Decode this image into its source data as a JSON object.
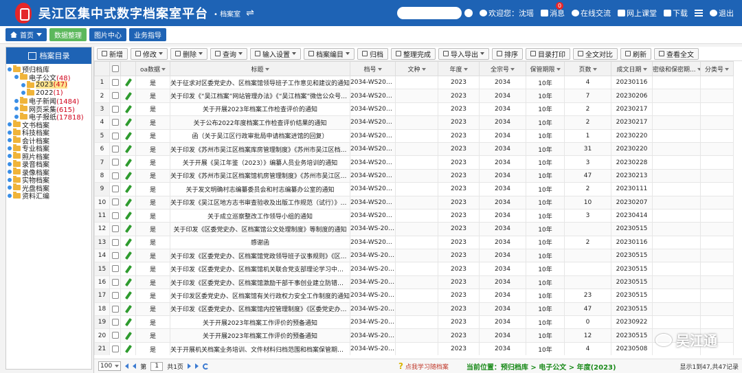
{
  "header": {
    "title": "吴江区集中式数字档案室平台",
    "subtitle": "• 档案室",
    "swap_icon": "swap-icon",
    "nav": [
      {
        "label": "欢迎您：沈瑶",
        "icon": "user-icon"
      },
      {
        "label": "消息",
        "icon": "mail-icon",
        "badge": "0"
      },
      {
        "label": "在线交流",
        "icon": "chat-icon"
      },
      {
        "label": "网上课堂",
        "icon": "screen-icon"
      },
      {
        "label": "下载",
        "icon": "download-icon"
      },
      {
        "label": "退出",
        "icon": "power-icon"
      }
    ]
  },
  "topmenu": {
    "home": "首页",
    "items": [
      "数据整理",
      "图片中心",
      "业务指导"
    ]
  },
  "sidebar": {
    "title": "档案目录",
    "tree": [
      {
        "label": "预归档库",
        "count": "",
        "level": 0
      },
      {
        "label": "电子公文",
        "count": "(48)",
        "level": 1
      },
      {
        "label": "2023",
        "count": "(47)",
        "level": 2,
        "selected": true
      },
      {
        "label": "2022",
        "count": "(1)",
        "level": 2
      },
      {
        "label": "电子新闻",
        "count": "(1484)",
        "level": 1
      },
      {
        "label": "网页采集",
        "count": "(615)",
        "level": 1
      },
      {
        "label": "电子报纸",
        "count": "(17818)",
        "level": 1
      },
      {
        "label": "文书档案",
        "count": "",
        "level": 0
      },
      {
        "label": "科技档案",
        "count": "",
        "level": 0
      },
      {
        "label": "会计档案",
        "count": "",
        "level": 0
      },
      {
        "label": "专业档案",
        "count": "",
        "level": 0
      },
      {
        "label": "照片档案",
        "count": "",
        "level": 0
      },
      {
        "label": "录音档案",
        "count": "",
        "level": 0
      },
      {
        "label": "录像档案",
        "count": "",
        "level": 0
      },
      {
        "label": "实物档案",
        "count": "",
        "level": 0
      },
      {
        "label": "光盘档案",
        "count": "",
        "level": 0
      },
      {
        "label": "资料汇编",
        "count": "",
        "level": 0
      }
    ]
  },
  "toolbar": [
    {
      "label": "新增",
      "caret": false
    },
    {
      "label": "修改",
      "caret": true
    },
    {
      "label": "删除",
      "caret": true
    },
    {
      "label": "查询",
      "caret": true
    },
    {
      "label": "输入设置",
      "caret": true
    },
    {
      "label": "档案编目",
      "caret": true
    },
    {
      "label": "归档",
      "caret": false
    },
    {
      "label": "整理完成",
      "caret": false
    },
    {
      "label": "导入导出",
      "caret": true
    },
    {
      "label": "排序",
      "caret": false
    },
    {
      "label": "目录打印",
      "caret": false
    },
    {
      "label": "全文对比",
      "caret": false
    },
    {
      "label": "刷新",
      "caret": false
    },
    {
      "label": "查看全文",
      "caret": false
    }
  ],
  "table": {
    "columns": [
      "",
      "",
      "",
      "oa数据",
      "标题",
      "档号",
      "文种",
      "年度",
      "全宗号",
      "保管期限",
      "页数",
      "成文日期",
      "密级和保密期...",
      "分类号"
    ],
    "rows": [
      [
        "1",
        "是",
        "关于征求对区委党史办、区档案馆领导班子工作意见和建议的通知",
        "2034-WS2023...",
        "",
        "2023",
        "2034",
        "10年",
        "4",
        "20230116",
        "",
        ""
      ],
      [
        "2",
        "是",
        "关于印发《“吴江档案”网站管理办法》《“吴江档案”微信公众号管理办...",
        "2034-WS2023...",
        "",
        "2023",
        "2034",
        "10年",
        "7",
        "20230206",
        "",
        ""
      ],
      [
        "3",
        "是",
        "关于开展2023年档案工作检查评价的通知",
        "2034-WS2023...",
        "",
        "2023",
        "2034",
        "10年",
        "2",
        "20230217",
        "",
        ""
      ],
      [
        "4",
        "是",
        "关于公布2022年度档案工作检查评价结果的通知",
        "2034-WS2023...",
        "",
        "2023",
        "2034",
        "10年",
        "2",
        "20230217",
        "",
        ""
      ],
      [
        "5",
        "是",
        "函（关于吴江区行政审批局申请档案进馆的回复）",
        "2034-WS2023...",
        "",
        "2023",
        "2034",
        "10年",
        "1",
        "20230220",
        "",
        ""
      ],
      [
        "6",
        "是",
        "关于印发《苏州市吴江区档案库房管理制度》《苏州市吴江区档案馆...",
        "2034-WS2023...",
        "",
        "2023",
        "2034",
        "10年",
        "31",
        "20230220",
        "",
        ""
      ],
      [
        "7",
        "是",
        "关于开展《吴江年鉴（2023）》编纂人员业务培训的通知",
        "2034-WS2023...",
        "",
        "2023",
        "2034",
        "10年",
        "3",
        "20230228",
        "",
        ""
      ],
      [
        "8",
        "是",
        "关于印发《苏州市吴江区档案馆机房管理制度》《苏州市吴江区数字档...",
        "2034-WS2023...",
        "",
        "2023",
        "2034",
        "10年",
        "47",
        "20230213",
        "",
        ""
      ],
      [
        "9",
        "是",
        "关于发文明确村志编纂委员会和村志编纂办公室的通知",
        "2034-WS2023...",
        "",
        "2023",
        "2034",
        "10年",
        "2",
        "20230111",
        "",
        ""
      ],
      [
        "10",
        "是",
        "关于印发《吴江区地方志书审查验收及出版工作规范（试行）》的通知",
        "2034-WS2023...",
        "",
        "2023",
        "2034",
        "10年",
        "10",
        "20230207",
        "",
        ""
      ],
      [
        "11",
        "是",
        "关于成立巡察整改工作领导小组的通知",
        "2034-WS2023...",
        "",
        "2023",
        "2034",
        "10年",
        "3",
        "20230414",
        "",
        ""
      ],
      [
        "12",
        "是",
        "关于印发《区委党史办、区档案馆公文处理制度》等制度的通知",
        "2034-WS-202...",
        "",
        "2023",
        "2034",
        "10年",
        "",
        "20230515",
        "",
        ""
      ],
      [
        "13",
        "是",
        "感谢函",
        "2034-WS2023...",
        "",
        "2023",
        "2034",
        "10年",
        "2",
        "20230116",
        "",
        ""
      ],
      [
        "14",
        "是",
        "关于印发《区委党史办、区档案馆党政领导班子议事规则》《区委党史...",
        "2034-WS-202...",
        "",
        "2023",
        "2034",
        "10年",
        "",
        "20230515",
        "",
        ""
      ],
      [
        "15",
        "是",
        "关于印发《区委党史办、区档案馆机关联合党支部理论学习中心组学习...",
        "2034-WS-202...",
        "",
        "2023",
        "2034",
        "10年",
        "",
        "20230515",
        "",
        ""
      ],
      [
        "16",
        "是",
        "关于印发《区委党史办、区档案馆激励干部干事创业建立防错容错纠错...",
        "2034-WS-202...",
        "",
        "2023",
        "2034",
        "10年",
        "",
        "20230515",
        "",
        ""
      ],
      [
        "17",
        "是",
        "关于印发区委党史办、区档案馆有关行政权力安全工作制度的通知",
        "2034-WS-202...",
        "",
        "2023",
        "2034",
        "10年",
        "23",
        "20230515",
        "",
        ""
      ],
      [
        "18",
        "是",
        "关于印发《区委党史办、区档案馆内控管理制度》《区委党史办、区档...",
        "2034-WS-202...",
        "",
        "2023",
        "2034",
        "10年",
        "47",
        "20230515",
        "",
        ""
      ],
      [
        "19",
        "是",
        "关于开展2023年档案工作评价的预备通知",
        "2034-WS-202...",
        "",
        "2023",
        "2034",
        "10年",
        "0",
        "20230922",
        "",
        ""
      ],
      [
        "20",
        "是",
        "关于开展2023年档案工作评价的预备通知",
        "2034-WS-202...",
        "",
        "2023",
        "2034",
        "10年",
        "12",
        "20230515",
        "",
        ""
      ],
      [
        "21",
        "是",
        "关于开展机关档案业务培训、文件材料归档范围和档案保管期限表三个...",
        "2034-WS-202...",
        "",
        "2023",
        "2034",
        "10年",
        "4",
        "20230508",
        "",
        ""
      ]
    ]
  },
  "pager": {
    "page_size": "100",
    "page_prefix": "第",
    "page_value": "1",
    "page_total": "共1页",
    "help": "点我学习随档案",
    "current_position": "当前位置：预归档库 > 电子公文 > 年度(2023)",
    "info": "显示1到47,共47记录"
  },
  "watermark": "吴江通"
}
